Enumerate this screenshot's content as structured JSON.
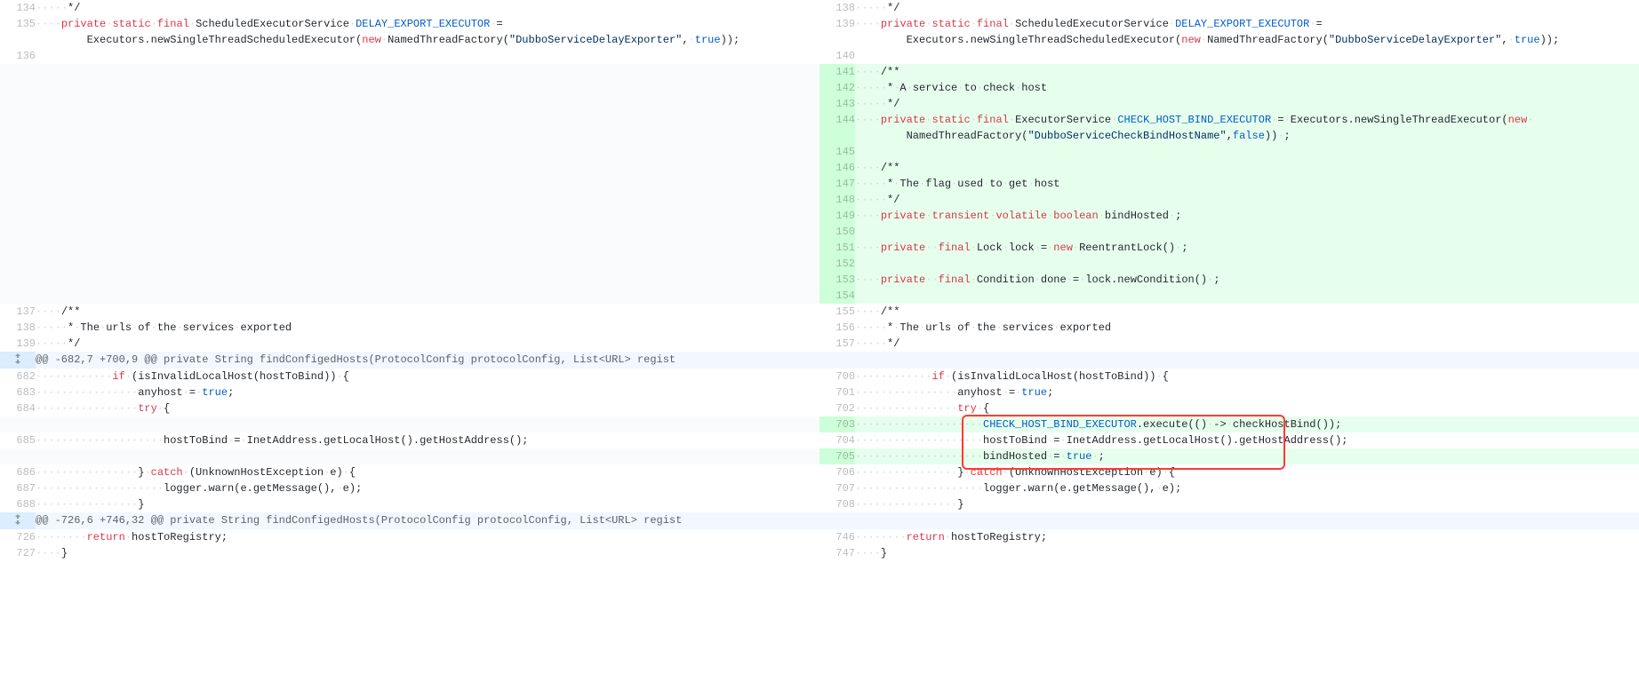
{
  "hunk1": "@@ -682,7 +700,9 @@ private String findConfigedHosts(ProtocolConfig protocolConfig, List<URL> regist",
  "hunk2": "@@ -726,6 +746,32 @@ private String findConfigedHosts(ProtocolConfig protocolConfig, List<URL> regist",
  "left": {
    "134": "     */",
    "135a": "    private static final ScheduledExecutorService DELAY_EXPORT_EXECUTOR =",
    "135b": "        Executors.newSingleThreadScheduledExecutor(new NamedThreadFactory(\"DubboServiceDelayExporter\", true));",
    "136": "",
    "137": "    /**",
    "138": "     * The urls of the services exported",
    "139": "     */",
    "682": "            if (isInvalidLocalHost(hostToBind)) {",
    "683": "                anyhost = true;",
    "684": "                try {",
    "685": "                    hostToBind = InetAddress.getLocalHost().getHostAddress();",
    "686": "                } catch (UnknownHostException e) {",
    "687": "                    logger.warn(e.getMessage(), e);",
    "688": "                }",
    "726": "        return hostToRegistry;",
    "727": "    }"
  },
  "right": {
    "138": "     */",
    "139a": "    private static final ScheduledExecutorService DELAY_EXPORT_EXECUTOR =",
    "139b": "        Executors.newSingleThreadScheduledExecutor(new NamedThreadFactory(\"DubboServiceDelayExporter\", true));",
    "140": "",
    "141": "    /**",
    "142": "     * A service to check host",
    "143": "     */",
    "144a": "    private static final ExecutorService CHECK_HOST_BIND_EXECUTOR = Executors.newSingleThreadExecutor(new ",
    "144b": "        NamedThreadFactory(\"DubboServiceCheckBindHostName\",false)) ;",
    "145": "",
    "146": "    /**",
    "147": "     * The flag used to get host",
    "148": "     */",
    "149": "    private transient volatile boolean bindHosted ;",
    "150": "",
    "151": "    private  final Lock lock = new ReentrantLock() ;",
    "152": "",
    "153": "    private  final Condition done = lock.newCondition() ;",
    "154": "",
    "155": "    /**",
    "156": "     * The urls of the services exported",
    "157": "     */",
    "700": "            if (isInvalidLocalHost(hostToBind)) {",
    "701": "                anyhost = true;",
    "702": "                try {",
    "703": "                    CHECK_HOST_BIND_EXECUTOR.execute(() -> checkHostBind());",
    "704": "                    hostToBind = InetAddress.getLocalHost().getHostAddress();",
    "705": "                    bindHosted = true ;",
    "706": "                } catch (UnknownHostException e) {",
    "707": "                    logger.warn(e.getMessage(), e);",
    "708": "                }",
    "746": "        return hostToRegistry;",
    "747": "    }"
  },
  "ln": {
    "l134": "134",
    "l135": "135",
    "l136": "136",
    "l137": "137",
    "l138": "138",
    "l139": "139",
    "l682": "682",
    "l683": "683",
    "l684": "684",
    "l685": "685",
    "l686": "686",
    "l687": "687",
    "l688": "688",
    "l726": "726",
    "l727": "727",
    "r138": "138",
    "r139": "139",
    "r140": "140",
    "r141": "141",
    "r142": "142",
    "r143": "143",
    "r144": "144",
    "r145": "145",
    "r146": "146",
    "r147": "147",
    "r148": "148",
    "r149": "149",
    "r150": "150",
    "r151": "151",
    "r152": "152",
    "r153": "153",
    "r154": "154",
    "r155": "155",
    "r156": "156",
    "r157": "157",
    "r700": "700",
    "r701": "701",
    "r702": "702",
    "r703": "703",
    "r704": "704",
    "r705": "705",
    "r706": "706",
    "r707": "707",
    "r708": "708",
    "r746": "746",
    "r747": "747"
  }
}
